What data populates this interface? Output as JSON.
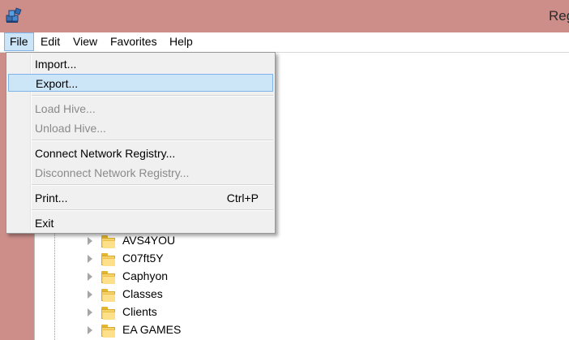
{
  "window": {
    "title": "Reg"
  },
  "menubar": {
    "items": [
      {
        "label": "File",
        "active": true
      },
      {
        "label": "Edit"
      },
      {
        "label": "View"
      },
      {
        "label": "Favorites"
      },
      {
        "label": "Help"
      }
    ]
  },
  "file_menu": {
    "items": [
      {
        "label": "Import...",
        "enabled": true
      },
      {
        "label": "Export...",
        "enabled": true,
        "highlighted": true
      },
      {
        "label": "Load Hive...",
        "enabled": false
      },
      {
        "label": "Unload Hive...",
        "enabled": false
      },
      {
        "label": "Connect Network Registry...",
        "enabled": true
      },
      {
        "label": "Disconnect Network Registry...",
        "enabled": false
      },
      {
        "label": "Print...",
        "shortcut": "Ctrl+P",
        "enabled": true
      },
      {
        "label": "Exit",
        "enabled": true
      }
    ]
  },
  "tree": {
    "items": [
      {
        "label": "AVS4YOU"
      },
      {
        "label": "C07ft5Y"
      },
      {
        "label": "Caphyon"
      },
      {
        "label": "Classes"
      },
      {
        "label": "Clients"
      },
      {
        "label": "EA GAMES"
      }
    ]
  },
  "colors": {
    "titlebar": "#cd8e8a",
    "menu_highlight": "#cde6f7",
    "menu_highlight_border": "#7eb4ea"
  },
  "icons": {
    "app": "registry-cubes-icon",
    "folder": "folder-icon",
    "expander": "expand-arrow-icon"
  }
}
